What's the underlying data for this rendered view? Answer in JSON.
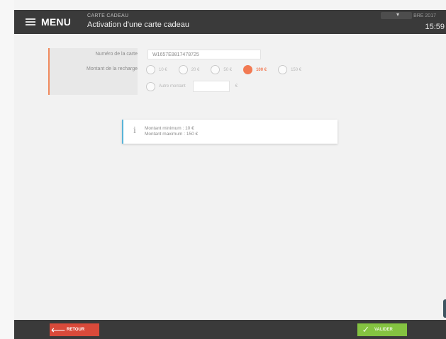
{
  "header": {
    "menu_label": "MENU",
    "section": "CARTE CADEAU",
    "title": "Activation d'une carte cadeau",
    "date": "MAR                      BRE 2017",
    "time": "15:59"
  },
  "form": {
    "card_label": "Numéro de la carte",
    "card_value": "W1657E8817478725",
    "amount_label": "Montant de la recharge",
    "options": [
      {
        "label": "10 €",
        "selected": false
      },
      {
        "label": "20 €",
        "selected": false
      },
      {
        "label": "50 €",
        "selected": false
      },
      {
        "label": "100 €",
        "selected": true
      },
      {
        "label": "150 €",
        "selected": false
      }
    ],
    "other_label": "Autre montant",
    "other_value": "",
    "euro_symbol": "€"
  },
  "info": {
    "min": "Montant minimum : 10 €",
    "max": "Montant maximum : 150 €"
  },
  "footer": {
    "back_label": "RETOUR",
    "validate_label": "VALIDER"
  },
  "colors": {
    "accent": "#f27a53",
    "back": "#d94a3a",
    "validate": "#84c341",
    "info_border": "#59b4d8",
    "bar": "#3a3a3a"
  }
}
